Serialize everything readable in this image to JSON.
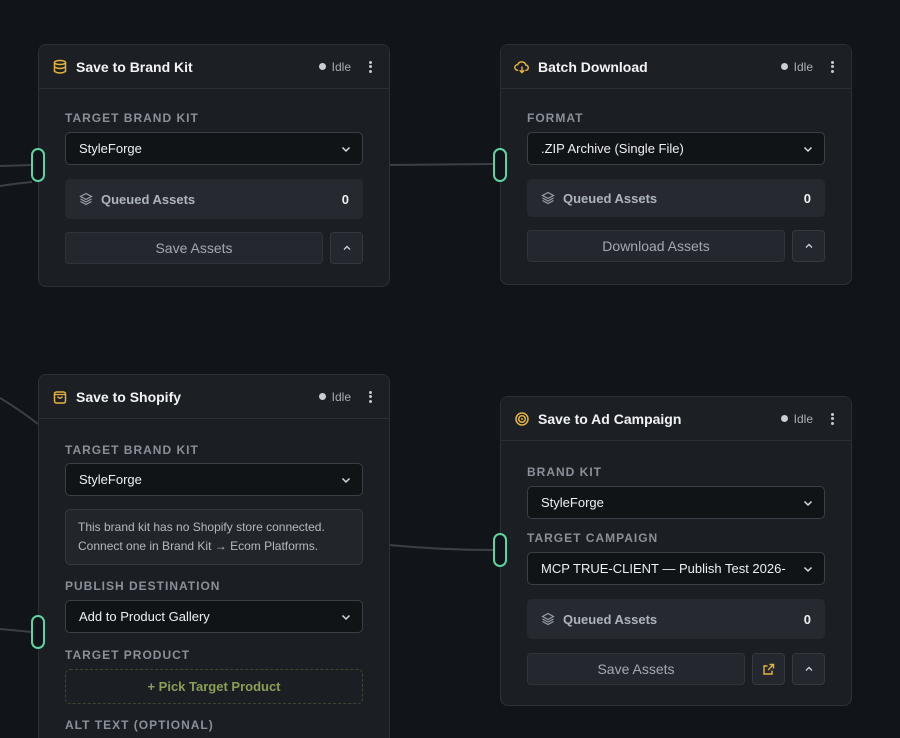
{
  "brand_kit_node": {
    "title": "Save to Brand Kit",
    "icon": "database-icon",
    "status": "Idle",
    "field_label": "Target Brand Kit",
    "select_value": "StyleForge",
    "queued_label": "Queued Assets",
    "queued_count": "0",
    "action_label": "Save Assets"
  },
  "batch_node": {
    "title": "Batch Download",
    "icon": "cloud-download-icon",
    "status": "Idle",
    "field_label": "Format",
    "select_value": ".ZIP Archive (Single File)",
    "queued_label": "Queued Assets",
    "queued_count": "0",
    "action_label": "Download Assets"
  },
  "shopify_node": {
    "title": "Save to Shopify",
    "icon": "shopping-bag-icon",
    "status": "Idle",
    "field_label": "Target Brand Kit",
    "select_value": "StyleForge",
    "notice_line1": "This brand kit has no Shopify store connected.",
    "notice_line2": "Connect one in Brand Kit → Ecom Platforms.",
    "publish_label": "Publish Destination",
    "publish_value": "Add to Product Gallery",
    "product_label": "Target Product",
    "pick_product": "+ Pick Target Product",
    "alt_label": "Alt Text (Optional)"
  },
  "campaign_node": {
    "title": "Save to Ad Campaign",
    "icon": "target-icon",
    "status": "Idle",
    "brand_label": "Brand Kit",
    "brand_value": "StyleForge",
    "campaign_label": "Target Campaign",
    "campaign_value": "MCP TRUE-CLIENT — Publish Test 2026-",
    "queued_label": "Queued Assets",
    "queued_count": "0",
    "action_label": "Save Assets"
  },
  "colors": {
    "background": "#111418",
    "node": "#1b1f24",
    "port": "#5fd4a0",
    "icon_accent": "#e5b43c"
  }
}
